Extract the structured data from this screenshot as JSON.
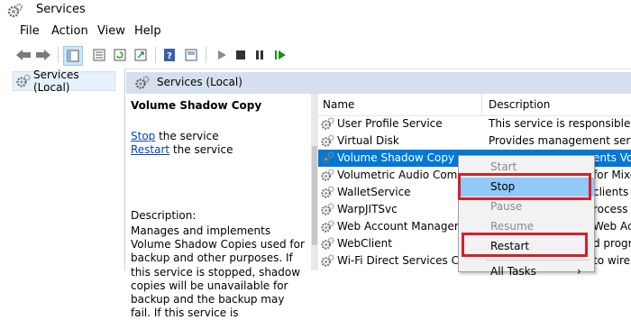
{
  "window": {
    "title": "Services",
    "icon": "gears-icon"
  },
  "menu": [
    "File",
    "Action",
    "View",
    "Help"
  ],
  "toolbar": {
    "buttons": [
      "back-arrow-icon",
      "forward-arrow-icon",
      "console-tree-icon",
      "properties-icon",
      "refresh-icon",
      "export-icon",
      "help-icon",
      "console-icon",
      "play-icon",
      "stop-icon",
      "pause-icon",
      "restart-icon"
    ]
  },
  "tree": {
    "item": "Services (Local)"
  },
  "panel": {
    "header": "Services (Local)"
  },
  "description": {
    "title": "Volume Shadow Copy",
    "stop_link": "Stop",
    "stop_rest": " the service",
    "restart_link": "Restart",
    "restart_rest": " the service",
    "label": "Description:",
    "text": "Manages and implements Volume Shadow Copies used for backup and other purposes. If this service is stopped, shadow copies will be unavailable for backup and the backup may fail. If this service is"
  },
  "columns": {
    "name": "Name",
    "description": "Description"
  },
  "services": [
    {
      "name": "User Profile Service",
      "description": "This service is responsible for lo"
    },
    {
      "name": "Virtual Disk",
      "description": "Provides management services"
    },
    {
      "name": "Volume Shadow Copy",
      "description": "ents Vol"
    },
    {
      "name": "Volumetric Audio Compo",
      "description": "for Mixe"
    },
    {
      "name": "WalletService",
      "description": "clients ."
    },
    {
      "name": "WarpJITSvc",
      "description": "rocess s"
    },
    {
      "name": "Web Account Manager",
      "description": "Web Ac"
    },
    {
      "name": "WebClient",
      "description": "d progra"
    },
    {
      "name": "Wi-Fi Direct Services Conn",
      "description": "to wirele"
    }
  ],
  "context_menu": {
    "items": [
      {
        "label": "Start",
        "enabled": false
      },
      {
        "label": "Stop",
        "enabled": true
      },
      {
        "label": "Pause",
        "enabled": false
      },
      {
        "label": "Resume",
        "enabled": false
      },
      {
        "label": "Restart",
        "enabled": true
      },
      {
        "label": "All Tasks",
        "enabled": true
      }
    ]
  },
  "colors": {
    "selection": "#0078d7",
    "highlight": "#d61f2b",
    "header": "#d5e0ee",
    "link": "#0645ad"
  }
}
